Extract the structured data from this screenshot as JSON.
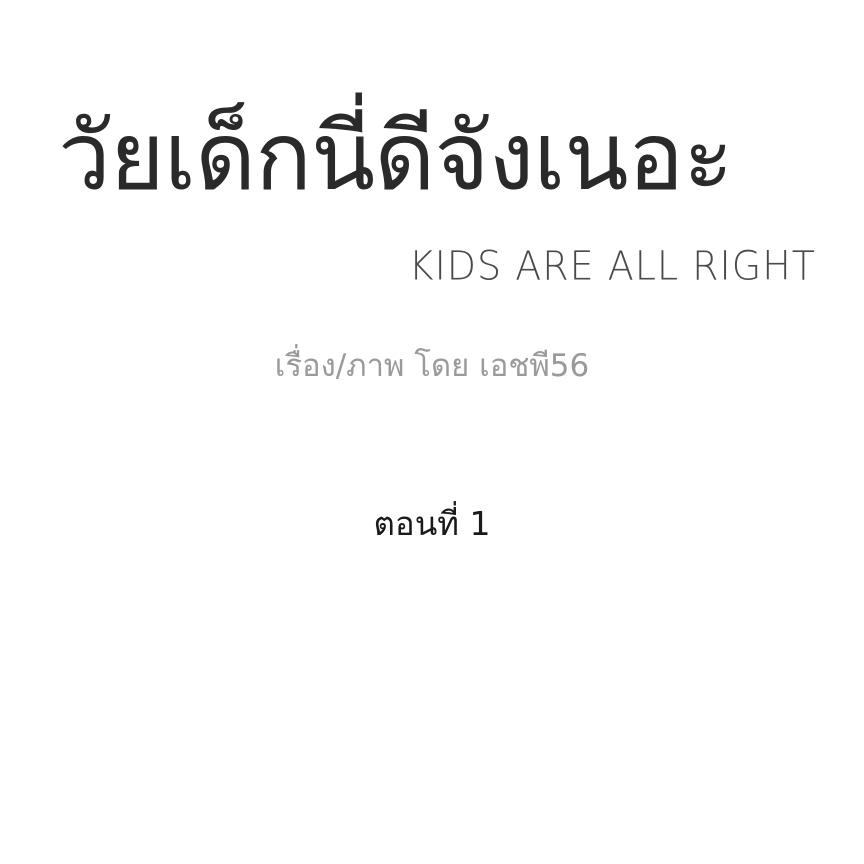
{
  "cover": {
    "title_thai": "วัยเด็กนี่ดีจังเนอะ",
    "title_english": "KIDS ARE ALL RIGHT",
    "credit": "เรื่อง/ภาพ โดย เอชพี56",
    "episode": "ตอนที่ 1"
  },
  "colors": {
    "background": "#ffffff",
    "title": "#2a2a2a",
    "subtitle": "#4a4a4a",
    "credit": "#9a9a9a",
    "episode": "#1a1a1a"
  }
}
